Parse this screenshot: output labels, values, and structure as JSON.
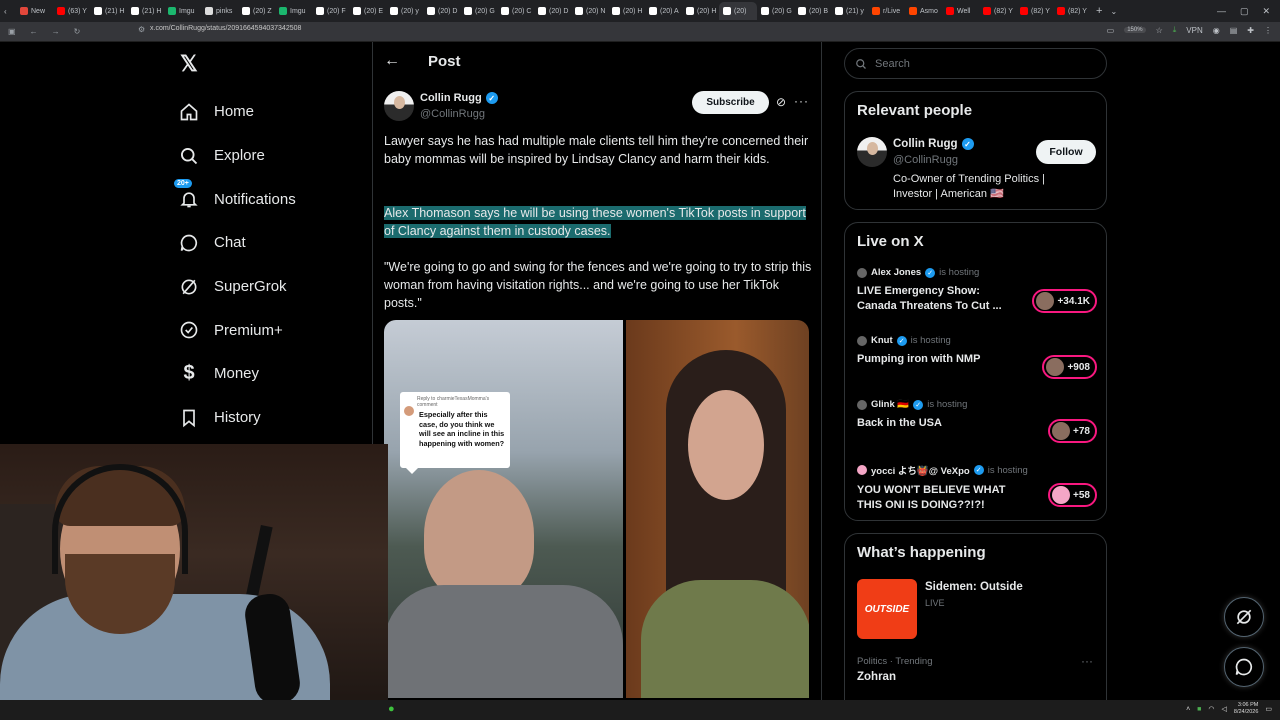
{
  "browser": {
    "tabs": [
      {
        "label": "New",
        "color": "#e2473b"
      },
      {
        "label": "(63) Y",
        "color": "#ff0000"
      },
      {
        "label": "(21) H",
        "color": "#ffffff"
      },
      {
        "label": "(21) H",
        "color": "#ffffff"
      },
      {
        "label": "Imgu",
        "color": "#1bb76e"
      },
      {
        "label": "pinks",
        "color": "#dddddd"
      },
      {
        "label": "(20) Z",
        "color": "#ffffff"
      },
      {
        "label": "Imgu",
        "color": "#1bb76e"
      },
      {
        "label": "(20) F",
        "color": "#ffffff"
      },
      {
        "label": "(20) E",
        "color": "#ffffff"
      },
      {
        "label": "(20) y",
        "color": "#ffffff"
      },
      {
        "label": "(20) D",
        "color": "#ffffff"
      },
      {
        "label": "(20) G",
        "color": "#ffffff"
      },
      {
        "label": "(20) C",
        "color": "#ffffff"
      },
      {
        "label": "(20) D",
        "color": "#ffffff"
      },
      {
        "label": "(20) N",
        "color": "#ffffff"
      },
      {
        "label": "(20) H",
        "color": "#ffffff"
      },
      {
        "label": "(20) A",
        "color": "#ffffff"
      },
      {
        "label": "(20) H",
        "color": "#ffffff"
      },
      {
        "label": "(20)",
        "color": "#ffffff"
      },
      {
        "label": "(20) G",
        "color": "#ffffff"
      },
      {
        "label": "(20) B",
        "color": "#ffffff"
      },
      {
        "label": "(21) y",
        "color": "#ffffff"
      },
      {
        "label": "r/Live",
        "color": "#ff4500"
      },
      {
        "label": "Asmo",
        "color": "#ff4500"
      },
      {
        "label": "Well",
        "color": "#ff0000"
      },
      {
        "label": "(82) Y",
        "color": "#ff0000"
      },
      {
        "label": "(82) Y",
        "color": "#ff0000"
      },
      {
        "label": "(82) Y",
        "color": "#ff0000"
      }
    ],
    "url": "x.com/CollinRugg/status/2091664594037342508",
    "zoom": "150%",
    "vpn_label": "VPN"
  },
  "nav": {
    "items": [
      {
        "label": "Home",
        "icon": "home-icon"
      },
      {
        "label": "Explore",
        "icon": "search-icon"
      },
      {
        "label": "Notifications",
        "icon": "bell-icon",
        "badge": "20+"
      },
      {
        "label": "Chat",
        "icon": "chat-icon"
      },
      {
        "label": "SuperGrok",
        "icon": "grok-icon"
      },
      {
        "label": "Premium+",
        "icon": "premium-icon"
      },
      {
        "label": "Money",
        "icon": "money-icon"
      },
      {
        "label": "History",
        "icon": "bookmark-icon"
      }
    ]
  },
  "post": {
    "header_title": "Post",
    "author_name": "Collin Rugg",
    "author_handle": "@CollinRugg",
    "subscribe_label": "Subscribe",
    "paragraph1": "Lawyer says he has had multiple male clients tell him they're concerned their baby mommas will be inspired by Lindsay Clancy and harm their kids.",
    "paragraph2": "Alex Thomason says he will be using these women's TikTok posts in support of Clancy against them in custody cases.",
    "paragraph3": "\"We're going to go and swing for the fences and we're going to try to strip this woman from having visitation rights... and we're going to use her TikTok posts.\"",
    "media_reply_meta": "Reply to charmieTexasMomma's comment",
    "media_reply_text": "Especially after this case, do you think we will see an incline in this happening with women?"
  },
  "sidebar": {
    "search_placeholder": "Search",
    "relevant_title": "Relevant people",
    "relevant": {
      "name": "Collin Rugg",
      "handle": "@CollinRugg",
      "bio": "Co-Owner of Trending Politics | Investor | American 🇺🇸",
      "follow_label": "Follow"
    },
    "live_title": "Live on X",
    "live": [
      {
        "host": "Alex Jones",
        "status": "is hosting",
        "title": "LIVE Emergency Show: Canada Threatens To Cut ...",
        "count": "+34.1K"
      },
      {
        "host": "Knut",
        "status": "is hosting",
        "title": "Pumping iron with NMP",
        "count": "+908"
      },
      {
        "host": "Glink 🇩🇪",
        "status": "is hosting",
        "title": "Back in the USA",
        "count": "+78"
      },
      {
        "host": "yocci よち👹@ VeXpo",
        "status": "is hosting",
        "title": "YOU WON'T BELIEVE WHAT THIS ONI IS DOING??!?!",
        "count": "+58"
      }
    ],
    "happening_title": "What’s happening",
    "trend_art_text": "OUTSIDE",
    "trend_feature_title": "Sidemen: Outside",
    "trend_feature_status": "LIVE",
    "trend_category": "Politics · Trending",
    "trend_name": "Zohran"
  },
  "taskbar": {
    "time": "3:06 PM",
    "date": "8/24/2026"
  }
}
